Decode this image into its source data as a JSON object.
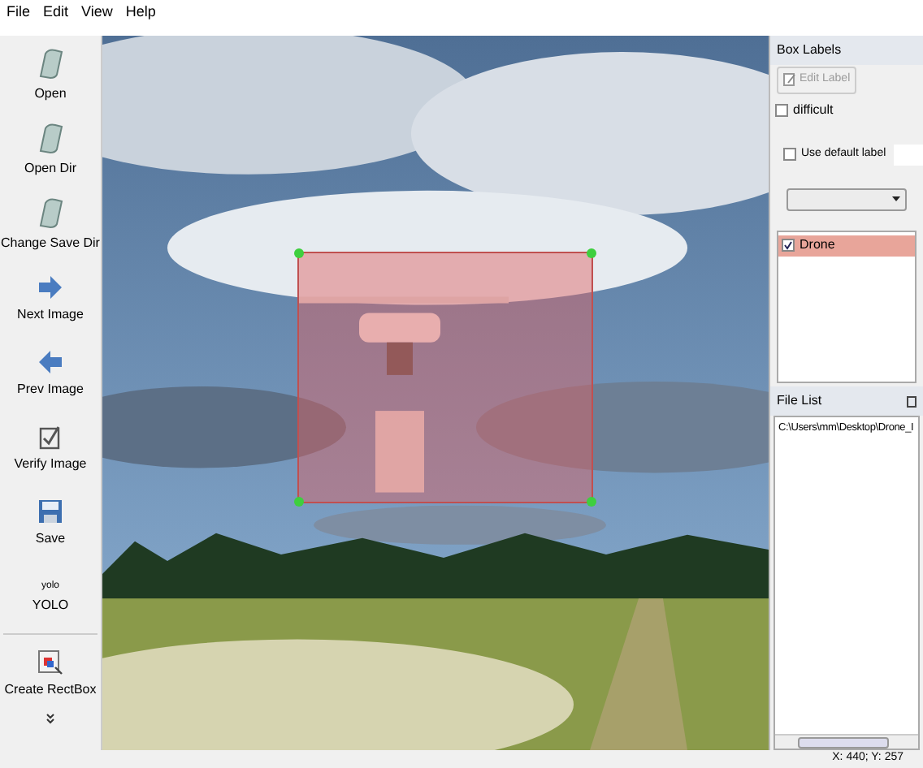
{
  "menu": [
    "File",
    "Edit",
    "View",
    "Help"
  ],
  "tools": [
    {
      "kind": "folder",
      "label": "Open"
    },
    {
      "kind": "folder",
      "label": "Open Dir"
    },
    {
      "kind": "folder",
      "label": "Change Save Dir"
    },
    {
      "kind": "next",
      "label": "Next Image"
    },
    {
      "kind": "prev",
      "label": "Prev Image"
    },
    {
      "kind": "verify",
      "label": "Verify Image"
    },
    {
      "kind": "save",
      "label": "Save"
    },
    {
      "kind": "text",
      "icon_text": "yolo",
      "label": "YOLO"
    },
    {
      "kind": "create",
      "label": "Create RectBox"
    }
  ],
  "canvas": {
    "box": {
      "selected": true
    }
  },
  "box_labels": {
    "title": "Box Labels",
    "edit_button": {
      "label": "Edit Label",
      "disabled": true
    },
    "difficult": {
      "label": "difficult",
      "checked": false
    },
    "use_default": {
      "label": "Use default label",
      "checked": false
    },
    "items": [
      {
        "label": "Drone",
        "checked": true,
        "selected": true
      }
    ]
  },
  "file_list": {
    "title": "File List",
    "items": [
      "C:\\Users\\mm\\Desktop\\Drone_I"
    ]
  },
  "status_bar": "X: 440; Y: 257"
}
